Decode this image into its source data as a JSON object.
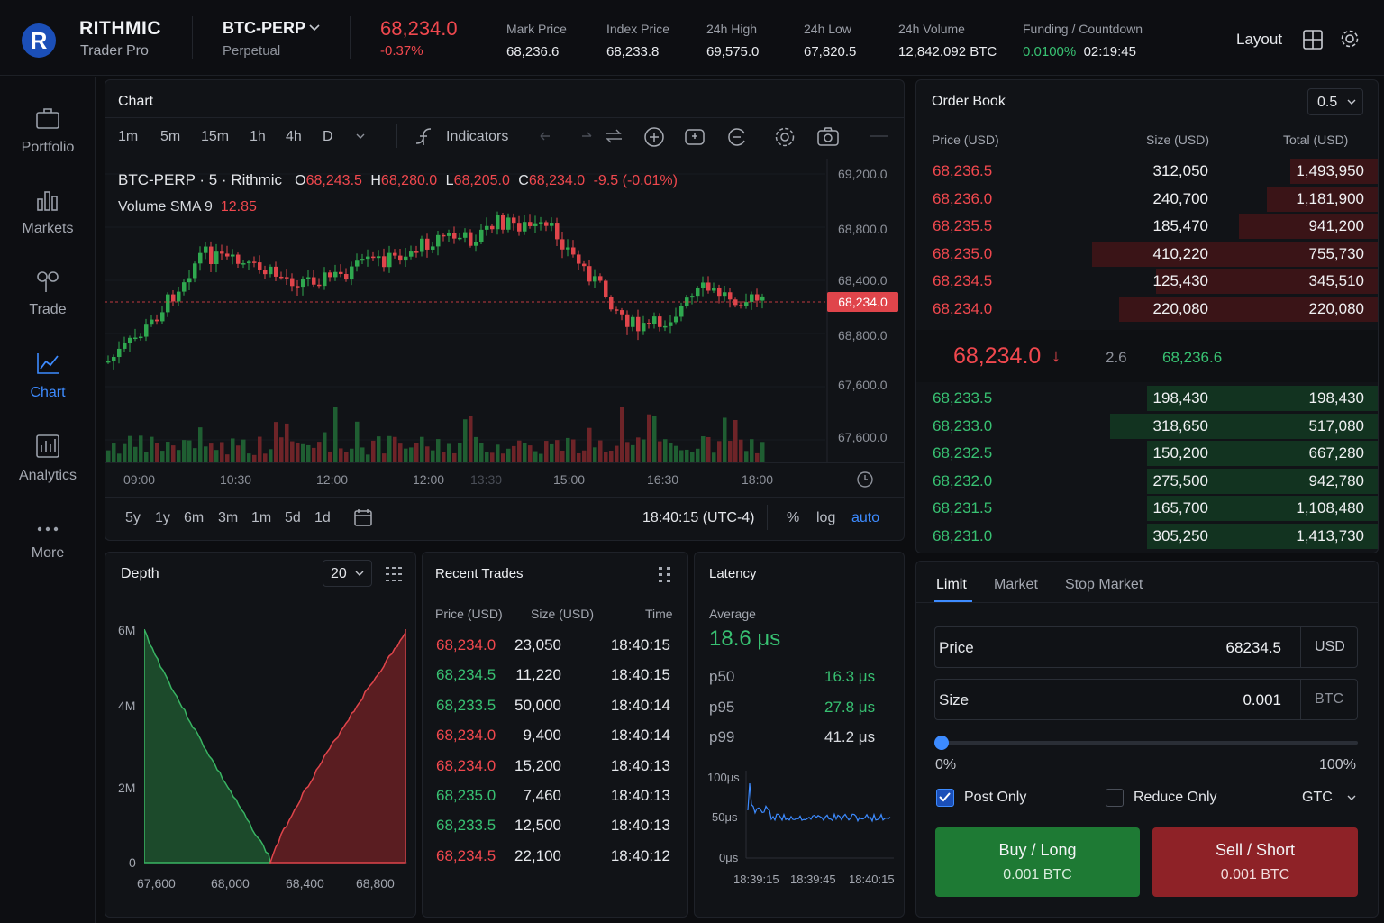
{
  "brand": {
    "name": "RITHMIC",
    "sub": "Trader Pro",
    "logo_letter": "R"
  },
  "symbol": {
    "name": "BTC-PERP",
    "type": "Perpetual"
  },
  "ticker": {
    "last": "68,234.0",
    "change": "-0.37%",
    "stats": [
      {
        "label": "Mark Price",
        "value": "68,236.6"
      },
      {
        "label": "Index Price",
        "value": "68,233.8"
      },
      {
        "label": "24h High",
        "value": "69,575.0"
      },
      {
        "label": "24h Low",
        "value": "67,820.5"
      },
      {
        "label": "24h Volume",
        "value": "12,842.092 BTC"
      }
    ],
    "funding": {
      "label": "Funding / Countdown",
      "rate": "0.0100%",
      "countdown": "02:19:45"
    }
  },
  "top_right": {
    "layout_label": "Layout",
    "icons": [
      "grid-icon",
      "gear-icon"
    ]
  },
  "sidebar": {
    "items": [
      {
        "label": "Portfolio",
        "icon": "briefcase-icon"
      },
      {
        "label": "Markets",
        "icon": "bar-chart-icon"
      },
      {
        "label": "Trade",
        "icon": "trade-icon"
      },
      {
        "label": "Chart",
        "icon": "line-chart-icon",
        "active": true
      },
      {
        "label": "Analytics",
        "icon": "analytics-icon"
      },
      {
        "label": "More",
        "icon": "more-icon"
      }
    ]
  },
  "chart": {
    "title": "Chart",
    "timeframes": [
      "1m",
      "5m",
      "15m",
      "1h",
      "4h",
      "D"
    ],
    "active_timeframes": [
      "5m",
      "15m"
    ],
    "indicators_label": "Indicators",
    "legend": {
      "symbol": "BTC-PERP · 5 · Rithmic",
      "o_label": "O",
      "o": "68,243.5",
      "h_label": "H",
      "h": "68,280.0",
      "l_label": "L",
      "l": "68,205.0",
      "c_label": "C",
      "c": "68,234.0",
      "chg": "-9.5 (-0.01%)",
      "volume_label": "Volume SMA 9",
      "volume_value": "12.85"
    },
    "y_labels": [
      "69,200.0",
      "68,800.0",
      "68,400.0",
      "68,800.0",
      "67,600.0",
      "67,600.0"
    ],
    "price_tag": "68,234.0",
    "x_labels": [
      "09:00",
      "10:30",
      "12:00",
      "12:00",
      "13:30",
      "15:00",
      "16:30",
      "18:00"
    ],
    "ranges": [
      "5y",
      "1y",
      "6m",
      "3m",
      "1m",
      "5d",
      "1d"
    ],
    "clock": "18:40:15 (UTC-4)",
    "scale_opts": [
      "%",
      "log",
      "auto"
    ],
    "colors": {
      "up": "#2fa84f",
      "down": "#e0454b"
    }
  },
  "order_book": {
    "title": "Order Book",
    "tick": "0.5",
    "headers": [
      "Price (USD)",
      "Size (USD)",
      "Total (USD)"
    ],
    "asks": [
      {
        "price": "68,236.5",
        "size": "312,050",
        "total": "1,493,950",
        "depth": 0.19
      },
      {
        "price": "68,236.0",
        "size": "240,700",
        "total": "1,181,900",
        "depth": 0.24
      },
      {
        "price": "68,235.5",
        "size": "185,470",
        "total": "941,200",
        "depth": 0.3
      },
      {
        "price": "68,235.0",
        "size": "410,220",
        "total": "755,730",
        "depth": 0.62
      },
      {
        "price": "68,234.5",
        "size": "125,430",
        "total": "345,510",
        "depth": 0.48
      },
      {
        "price": "68,234.0",
        "size": "220,080",
        "total": "220,080",
        "depth": 0.56
      }
    ],
    "mid": {
      "price": "68,234.0",
      "arrow": "↓",
      "spread": "2.6",
      "mark": "68,236.6"
    },
    "bids": [
      {
        "price": "68,233.5",
        "size": "198,430",
        "total": "198,430",
        "depth": 0.5
      },
      {
        "price": "68,233.0",
        "size": "318,650",
        "total": "517,080",
        "depth": 0.58
      },
      {
        "price": "68,232.5",
        "size": "150,200",
        "total": "667,280",
        "depth": 0.5
      },
      {
        "price": "68,232.0",
        "size": "275,500",
        "total": "942,780",
        "depth": 0.5
      },
      {
        "price": "68,231.5",
        "size": "165,700",
        "total": "1,108,480",
        "depth": 0.5
      },
      {
        "price": "68,231.0",
        "size": "305,250",
        "total": "1,413,730",
        "depth": 0.5
      }
    ]
  },
  "depth": {
    "title": "Depth",
    "levels": "20",
    "y_labels": [
      "6M",
      "4M",
      "2M",
      "0"
    ],
    "x_labels": [
      "67,600",
      "68,000",
      "68,400",
      "68,800"
    ]
  },
  "recent_trades": {
    "title": "Recent Trades",
    "headers": [
      "Price (USD)",
      "Size (USD)",
      "Time"
    ],
    "rows": [
      {
        "price": "68,234.0",
        "size": "23,050",
        "time": "18:40:15",
        "side": "sell"
      },
      {
        "price": "68,234.5",
        "size": "11,220",
        "time": "18:40:15",
        "side": "buy"
      },
      {
        "price": "68,233.5",
        "size": "50,000",
        "time": "18:40:14",
        "side": "buy"
      },
      {
        "price": "68,234.0",
        "size": "9,400",
        "time": "18:40:14",
        "side": "sell"
      },
      {
        "price": "68,234.0",
        "size": "15,200",
        "time": "18:40:13",
        "side": "sell"
      },
      {
        "price": "68,235.0",
        "size": "7,460",
        "time": "18:40:13",
        "side": "buy"
      },
      {
        "price": "68,233.5",
        "size": "12,500",
        "time": "18:40:13",
        "side": "buy"
      },
      {
        "price": "68,234.5",
        "size": "22,100",
        "time": "18:40:12",
        "side": "sell"
      }
    ]
  },
  "latency": {
    "title": "Latency",
    "avg_label": "Average",
    "avg": "18.6 μs",
    "percentiles": [
      {
        "label": "p50",
        "value": "16.3 μs"
      },
      {
        "label": "p95",
        "value": "27.8 μs"
      },
      {
        "label": "p99",
        "value": "41.2 μs"
      }
    ],
    "y_labels": [
      "100μs",
      "50μs",
      "0μs"
    ],
    "x_labels": [
      "18:39:15",
      "18:39:45",
      "18:40:15"
    ]
  },
  "order_form": {
    "tabs": [
      "Limit",
      "Market",
      "Stop Market"
    ],
    "price_label": "Price",
    "price_value": "68234.5",
    "price_unit": "USD",
    "size_label": "Size",
    "size_value": "0.001",
    "size_unit": "BTC",
    "slider_min": "0%",
    "slider_max": "100%",
    "slider_value": 0,
    "post_only": "Post Only",
    "post_only_checked": true,
    "reduce_only": "Reduce Only",
    "reduce_only_checked": false,
    "tif": "GTC",
    "buy_label": "Buy / Long",
    "buy_qty": "0.001 BTC",
    "sell_label": "Sell / Short",
    "sell_qty": "0.001 BTC"
  }
}
